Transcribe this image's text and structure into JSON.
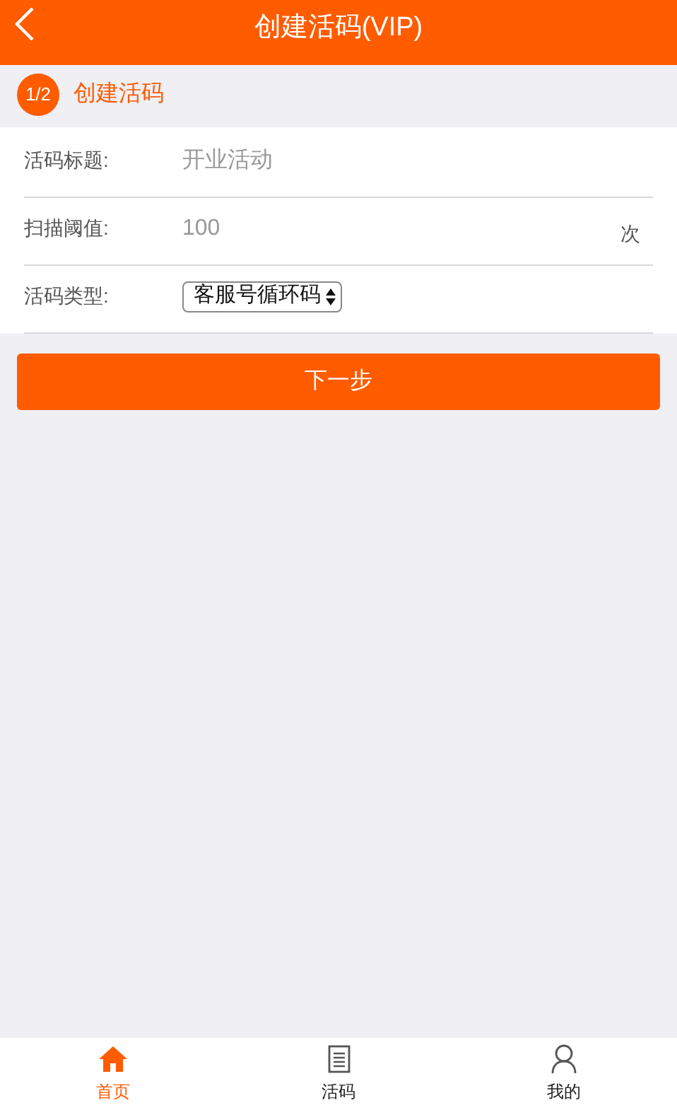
{
  "header": {
    "title": "创建活码(VIP)"
  },
  "step": {
    "number": "1/2",
    "label": "创建活码"
  },
  "form": [
    {
      "kind": "text",
      "label": "活码标题:",
      "placeholder": "开业活动"
    },
    {
      "kind": "number",
      "label": "扫描阈值:",
      "placeholder": "100",
      "unit": "次"
    },
    {
      "kind": "select",
      "label": "活码类型:",
      "value": "客服号循环码"
    }
  ],
  "next_button": "下一步",
  "nav": [
    {
      "kind": "home",
      "label": "首页",
      "selected": true
    },
    {
      "kind": "doc",
      "label": "活码",
      "selected": false
    },
    {
      "kind": "user",
      "label": "我的",
      "selected": false
    }
  ]
}
